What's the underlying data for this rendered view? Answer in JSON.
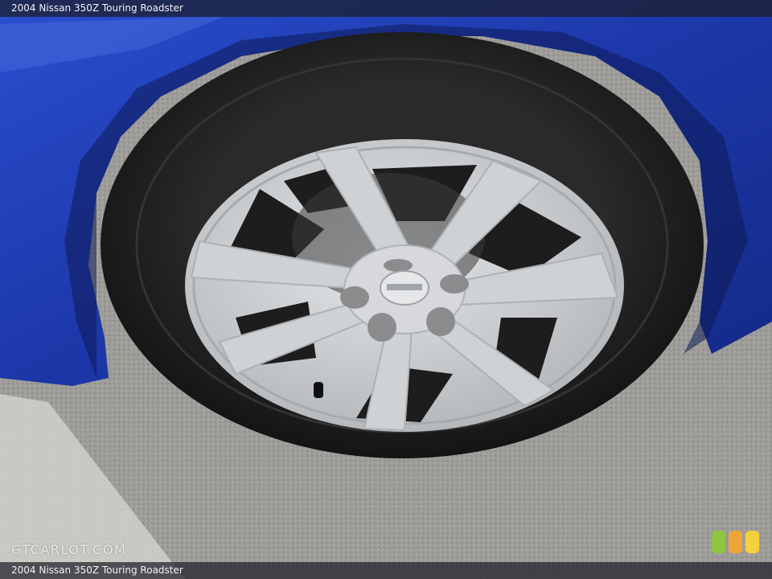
{
  "caption": {
    "top": "2004 Nissan 350Z Touring Roadster",
    "bottom": "2004 Nissan 350Z Touring Roadster"
  },
  "watermark": "GTCARLOT.COM",
  "photo": {
    "subject": "wheel",
    "icon": "car-wheel-photo"
  },
  "colors": {
    "car_body": "#1f3fb8",
    "tire": "#1e1e1e",
    "rim": "#c9cccf",
    "asphalt": "#9b9a96",
    "badge_green": "#8fc640",
    "badge_orange": "#f0a53a",
    "badge_yellow": "#f2d23c"
  }
}
